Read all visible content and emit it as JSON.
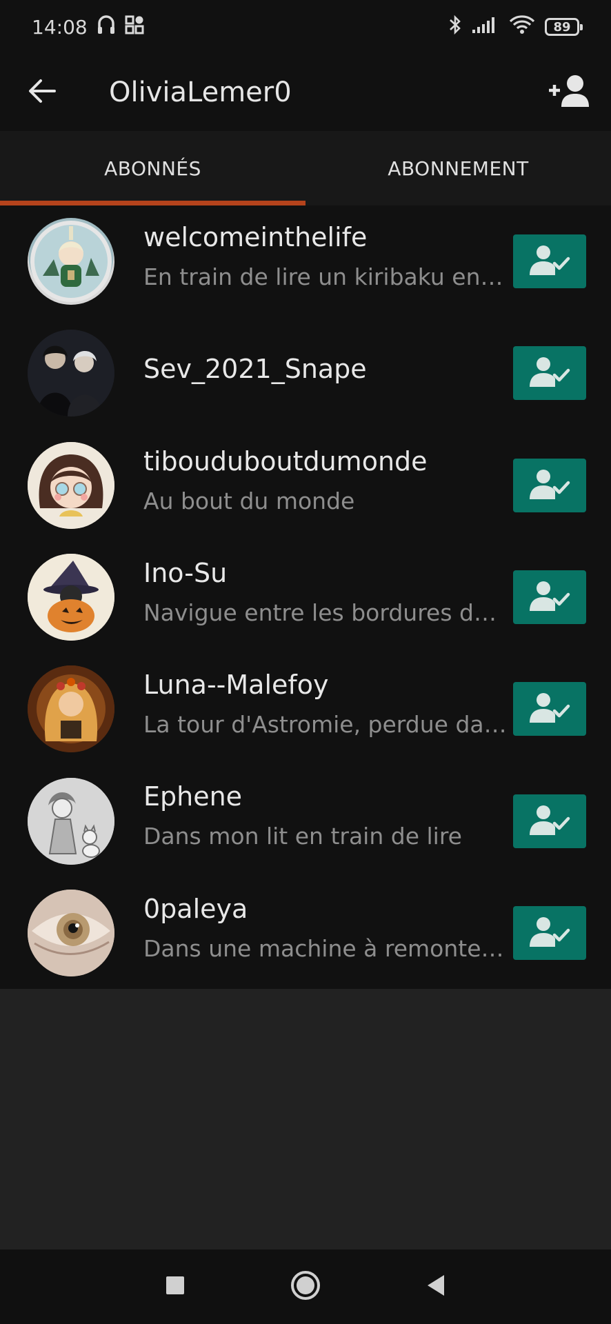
{
  "status_bar": {
    "time": "14:08",
    "battery": "89",
    "icons": [
      "headphones-icon",
      "app-grid-icon",
      "bluetooth-icon",
      "signal-icon",
      "wifi-icon",
      "battery-icon"
    ]
  },
  "app_bar": {
    "title": "OliviaLemer0",
    "back_icon": "arrow-left-icon",
    "add_user_icon": "add-user-icon"
  },
  "tabs": [
    {
      "label": "ABONNÉS",
      "active": true
    },
    {
      "label": "ABONNEMENT",
      "active": false
    }
  ],
  "colors": {
    "accent": "#b5431c",
    "follow_button": "#087364"
  },
  "followers": [
    {
      "username": "welcomeinthelife",
      "subtitle": "En train de lire un kiribaku en ...",
      "avatar": "chibi-character-avatar"
    },
    {
      "username": "Sev_2021_Snape",
      "subtitle": "",
      "avatar": "two-characters-avatar"
    },
    {
      "username": "tibouduboutdumonde",
      "subtitle": "Au bout du monde",
      "avatar": "girl-glasses-avatar"
    },
    {
      "username": "Ino-Su",
      "subtitle": "Navigue entre les bordures de ...",
      "avatar": "halloween-pumpkin-avatar"
    },
    {
      "username": "Luna--Malefoy",
      "subtitle": "La tour d'Astromie, perdue dan...",
      "avatar": "girl-with-book-avatar"
    },
    {
      "username": "Ephene",
      "subtitle": "Dans mon lit en train de lire",
      "avatar": "sketch-girl-cat-avatar"
    },
    {
      "username": "0paleya",
      "subtitle": "Dans une machine à remonter...",
      "avatar": "eye-closeup-avatar"
    }
  ],
  "nav_bar": {
    "icons": [
      "recents-square-icon",
      "home-circle-icon",
      "back-triangle-icon"
    ]
  }
}
